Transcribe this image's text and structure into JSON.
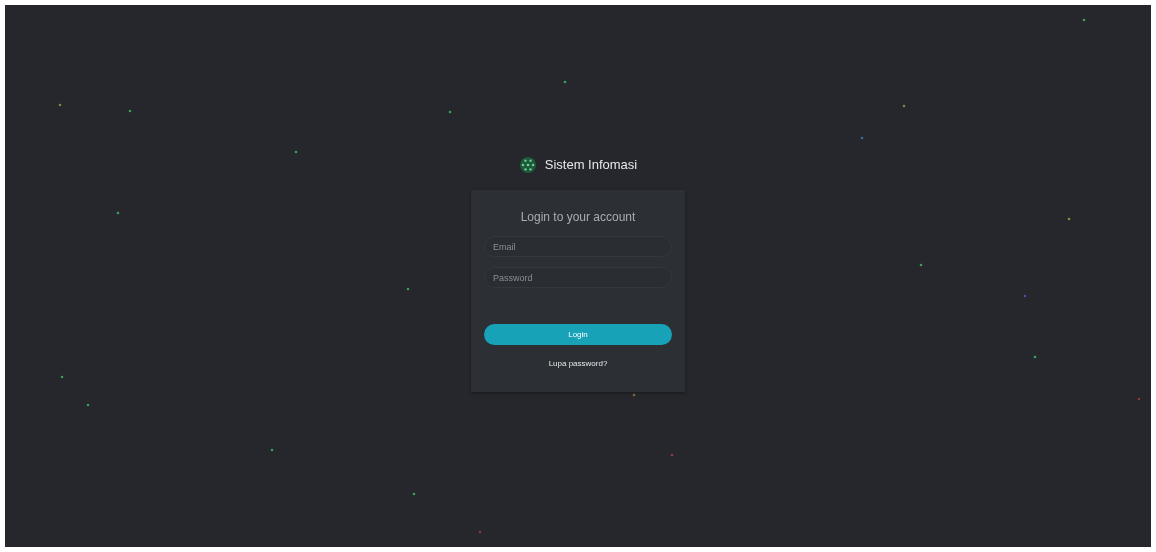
{
  "brand": {
    "title": "Sistem Infomasi"
  },
  "login": {
    "heading": "Login to your account",
    "email": {
      "placeholder": "Email"
    },
    "password": {
      "placeholder": "Password"
    },
    "submit": "Login",
    "forgot_link": "Lupa password?"
  }
}
